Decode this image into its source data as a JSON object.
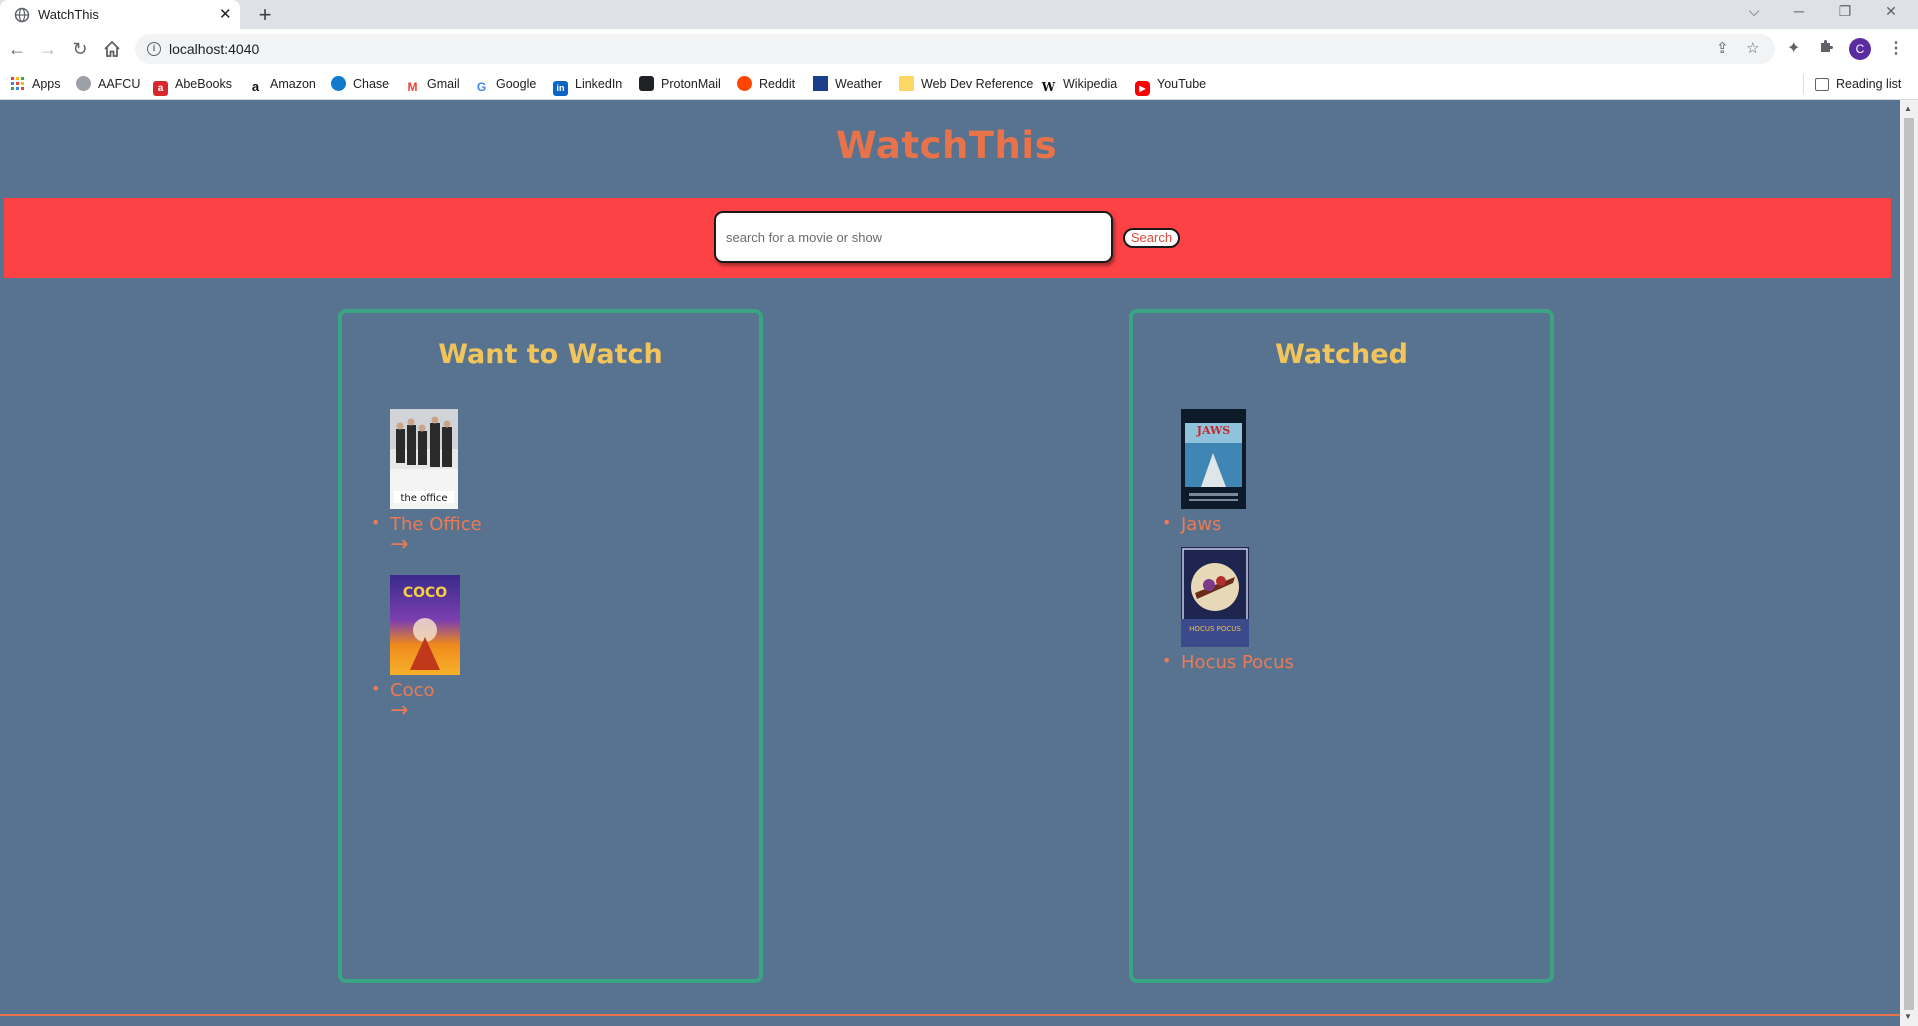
{
  "browser": {
    "tab_title": "WatchThis",
    "tab_close": "✕",
    "new_tab": "+",
    "url": "localhost:4040",
    "window_controls": [
      "⌵",
      "─",
      "❐",
      "✕"
    ],
    "bookmarks": [
      {
        "label": "Apps",
        "icon": "apps-grid-icon",
        "color": "#ea4335"
      },
      {
        "label": "AAFCU",
        "icon": "globe-icon",
        "color": "#9aa0a6"
      },
      {
        "label": "AbeBooks",
        "icon": "abebooks-icon",
        "color": "#d9272e"
      },
      {
        "label": "Amazon",
        "icon": "amazon-icon",
        "color": "#ffffff"
      },
      {
        "label": "Chase",
        "icon": "chase-icon",
        "color": "#117aca"
      },
      {
        "label": "Gmail",
        "icon": "gmail-icon",
        "color": "#ffffff"
      },
      {
        "label": "Google",
        "icon": "google-icon",
        "color": "#ffffff"
      },
      {
        "label": "LinkedIn",
        "icon": "linkedin-icon",
        "color": "#0a66c2"
      },
      {
        "label": "ProtonMail",
        "icon": "protonmail-icon",
        "color": "#202124"
      },
      {
        "label": "Reddit",
        "icon": "reddit-icon",
        "color": "#ff4500"
      },
      {
        "label": "Weather",
        "icon": "weather-icon",
        "color": "#1b3f8b"
      },
      {
        "label": "Web Dev Reference",
        "icon": "folder-icon",
        "color": "#fdd663"
      },
      {
        "label": "Wikipedia",
        "icon": "wikipedia-icon",
        "color": "#ffffff"
      },
      {
        "label": "YouTube",
        "icon": "youtube-icon",
        "color": "#ff0000"
      }
    ],
    "reading_list": "Reading list",
    "profile_initial": "C"
  },
  "page": {
    "app_title": "WatchThis",
    "search": {
      "placeholder": "search for a movie or show",
      "button_label": "Search"
    },
    "columns": {
      "want": {
        "heading": "Want to Watch",
        "items": [
          {
            "title": "The Office",
            "arrow": "→"
          },
          {
            "title": "Coco",
            "arrow": "→"
          }
        ]
      },
      "watched": {
        "heading": "Watched",
        "items": [
          {
            "title": "Jaws"
          },
          {
            "title": "Hocus Pocus"
          }
        ]
      }
    }
  },
  "colors": {
    "page_bg": "#57738f",
    "title": "#e8734a",
    "search_band": "#fd4245",
    "column_border": "#3aa585",
    "column_heading": "#f2c55c",
    "item_text": "#ec7a55"
  }
}
